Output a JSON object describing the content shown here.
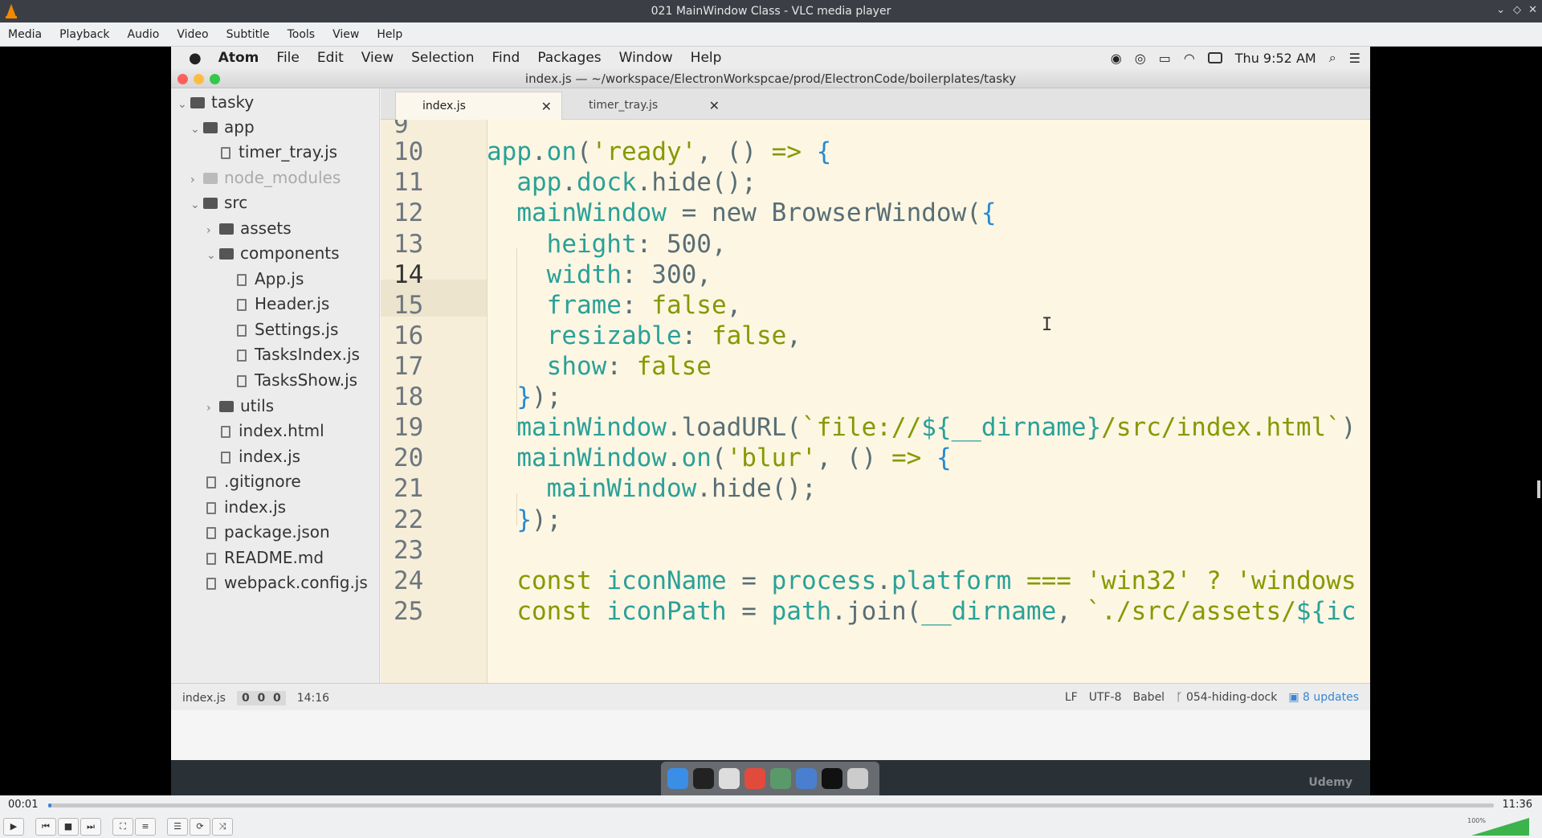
{
  "vlc": {
    "title": "021 MainWindow Class - VLC media player",
    "menu": [
      "Media",
      "Playback",
      "Audio",
      "Video",
      "Subtitle",
      "Tools",
      "View",
      "Help"
    ],
    "time_elapsed": "00:01",
    "time_total": "11:36",
    "progress": 0.002,
    "volume_label": "100%",
    "volume": 1.0
  },
  "mac": {
    "menu": [
      "Atom",
      "File",
      "Edit",
      "View",
      "Selection",
      "Find",
      "Packages",
      "Window",
      "Help"
    ],
    "clock": "Thu 9:52 AM"
  },
  "atom": {
    "window_title": "index.js — ~/workspace/ElectronWorkspcae/prod/ElectronCode/boilerplates/tasky",
    "tabs": [
      {
        "label": "index.js",
        "active": true
      },
      {
        "label": "timer_tray.js",
        "active": false
      }
    ],
    "tree": [
      {
        "label": "tasky",
        "type": "folder",
        "open": true
      },
      {
        "label": "app",
        "type": "folder",
        "open": true
      },
      {
        "label": "timer_tray.js",
        "type": "file"
      },
      {
        "label": "node_modules",
        "type": "folder",
        "open": false
      },
      {
        "label": "src",
        "type": "folder",
        "open": true
      },
      {
        "label": "assets",
        "type": "folder",
        "open": false
      },
      {
        "label": "components",
        "type": "folder",
        "open": true
      },
      {
        "label": "App.js",
        "type": "file"
      },
      {
        "label": "Header.js",
        "type": "file"
      },
      {
        "label": "Settings.js",
        "type": "file"
      },
      {
        "label": "TasksIndex.js",
        "type": "file"
      },
      {
        "label": "TasksShow.js",
        "type": "file"
      },
      {
        "label": "utils",
        "type": "folder",
        "open": false
      },
      {
        "label": "index.html",
        "type": "file"
      },
      {
        "label": "index.js",
        "type": "file"
      },
      {
        "label": ".gitignore",
        "type": "file"
      },
      {
        "label": "index.js",
        "type": "file"
      },
      {
        "label": "package.json",
        "type": "file"
      },
      {
        "label": "README.md",
        "type": "file"
      },
      {
        "label": "webpack.config.js",
        "type": "file"
      }
    ],
    "line_numbers": [
      "9",
      "10",
      "11",
      "12",
      "13",
      "14",
      "15",
      "16",
      "17",
      "18",
      "19",
      "20",
      "21",
      "22",
      "23",
      "24",
      "25"
    ],
    "current_line": "14",
    "status": {
      "file": "index.js",
      "counts": [
        "0",
        "0",
        "0"
      ],
      "cursor": "14:16",
      "eol": "LF",
      "encoding": "UTF-8",
      "grammar": "Babel",
      "branch": "054-hiding-dock",
      "updates": "8 updates"
    }
  },
  "watermark": "Udemy"
}
